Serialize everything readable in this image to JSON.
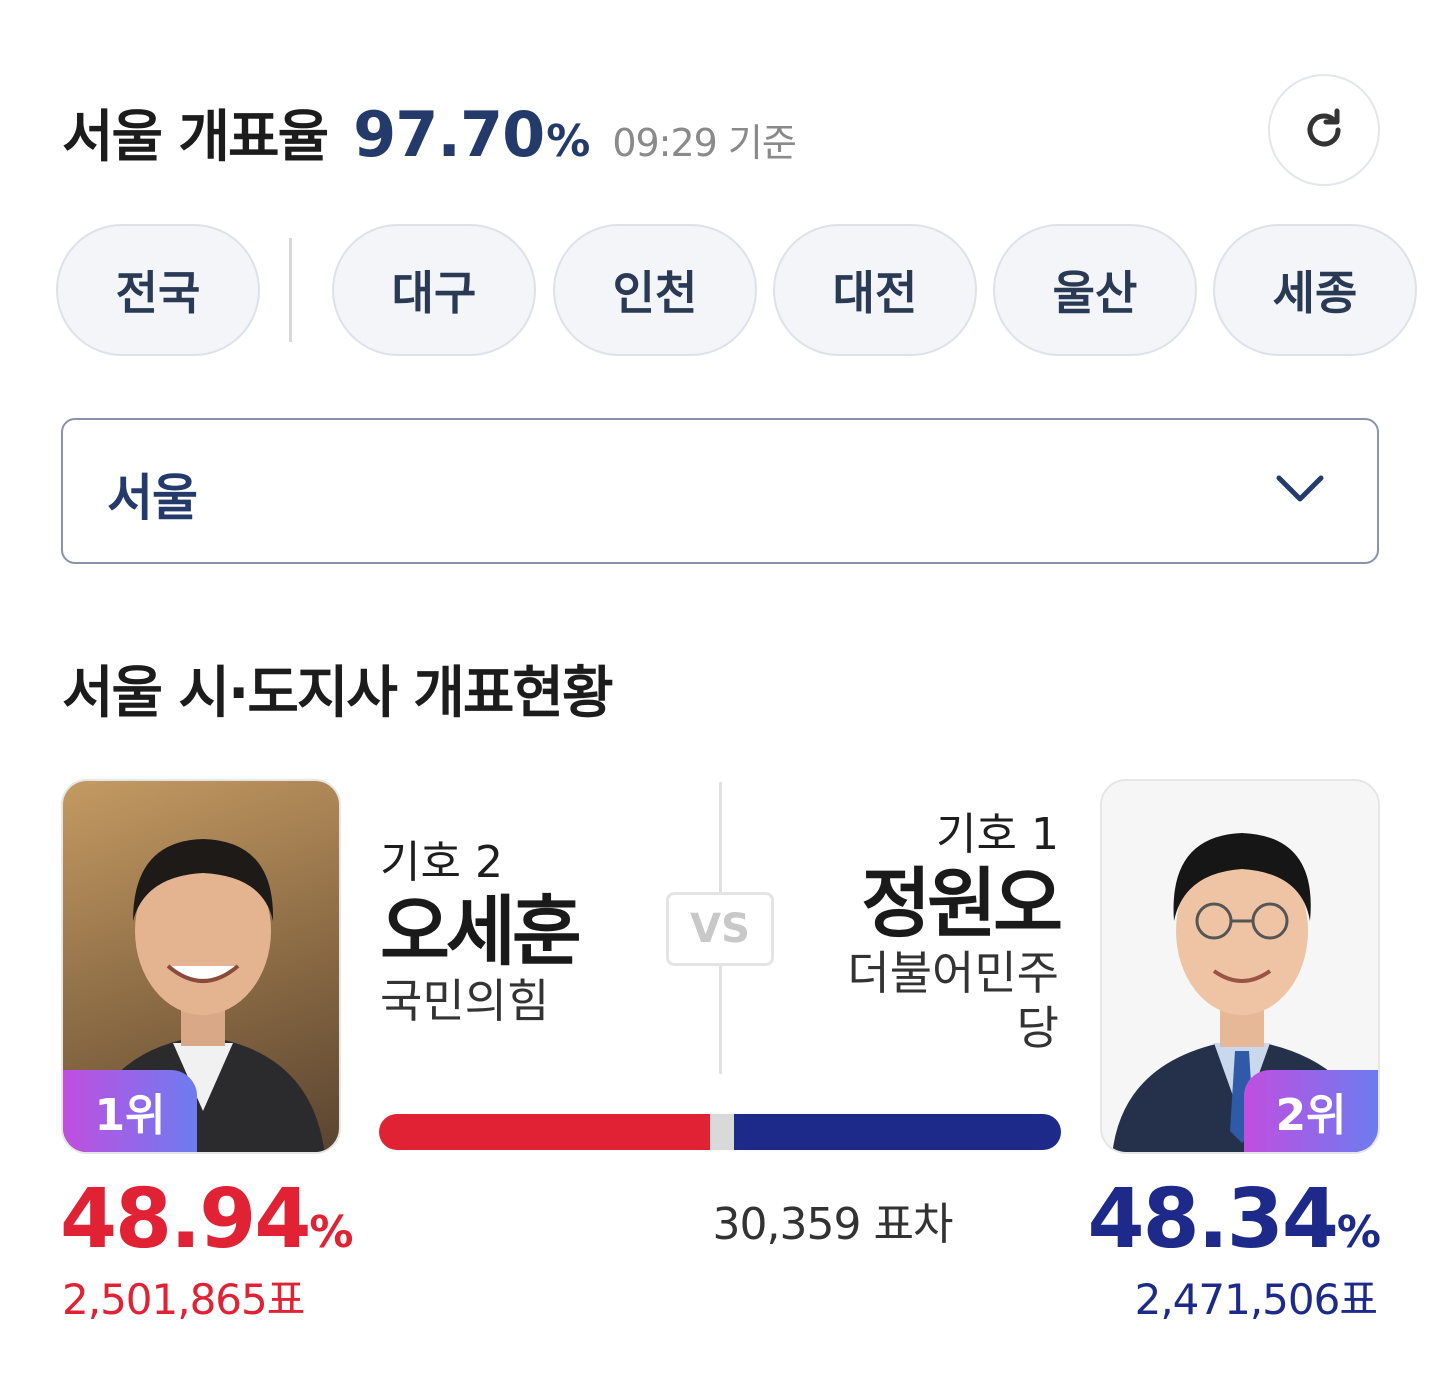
{
  "header": {
    "title": "서울 개표율",
    "rate": "97.70",
    "rate_unit": "%",
    "time": "09:29 기준"
  },
  "refresh": {
    "icon": "refresh-icon"
  },
  "regions": [
    "전국",
    "대구",
    "인천",
    "대전",
    "울산",
    "세종"
  ],
  "select": {
    "value": "서울",
    "icon": "chevron-down-icon"
  },
  "section": {
    "title": "서울 시·도지사 개표현황"
  },
  "candidates": {
    "left": {
      "number": "기호 2",
      "name": "오세훈",
      "party": "국민의힘",
      "rank": "1위",
      "percent": "48.94",
      "percent_unit": "%",
      "votes": "2,501,865표",
      "color": "#e12134"
    },
    "right": {
      "number": "기호 1",
      "name": "정원오",
      "party": "더불어민주당",
      "rank": "2위",
      "percent": "48.34",
      "percent_unit": "%",
      "votes": "2,471,506표",
      "color": "#1e2a8a"
    }
  },
  "vs_label": "VS",
  "vote_bar": {
    "left_share": 48.94,
    "right_share": 48.34
  },
  "difference": "30,359 표차"
}
